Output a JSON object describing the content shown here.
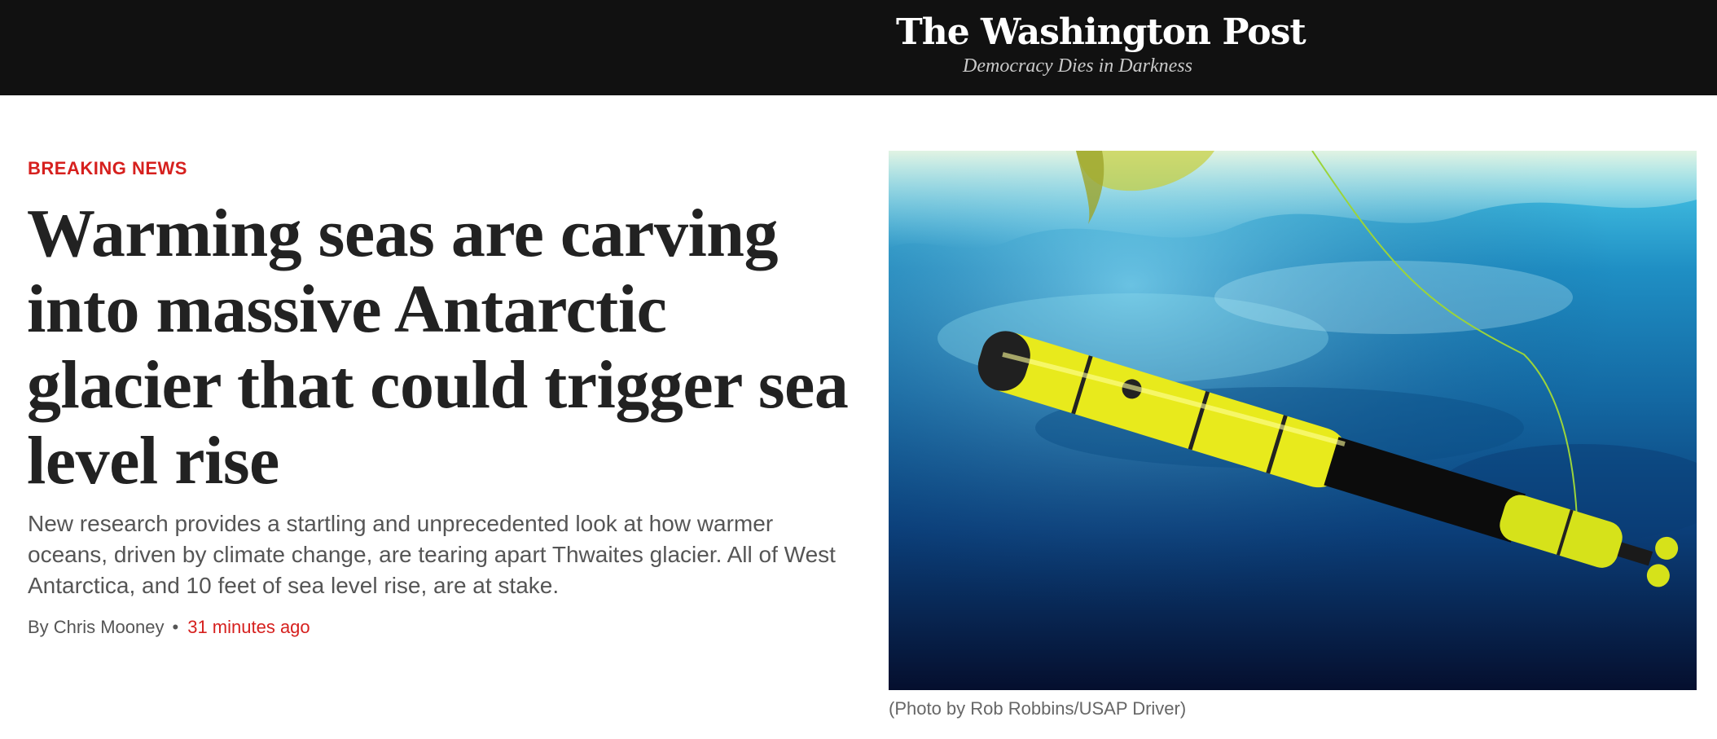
{
  "masthead": {
    "logo": "The Washington Post",
    "tagline": "Democracy Dies in Darkness"
  },
  "story": {
    "kicker": "BREAKING NEWS",
    "headline": "Warming seas are carving into massive Antarctic glacier that could trigger sea level rise",
    "dek": "New research provides a startling and unprecedented look at how warmer oceans, driven by climate change, are tearing apart Thwaites glacier. All of West Antarctica, and 10 feet of sea level rise, are at stake.",
    "byline": "By Chris Mooney",
    "byline_separator": "•",
    "timestamp": "31 minutes ago"
  },
  "photo": {
    "caption": "(Photo by Rob Robbins/USAP Driver)",
    "colors": {
      "water_top": "#4fd0ec",
      "water_bottom": "#050f2e",
      "vehicle_yellow": "#e8ea1c",
      "vehicle_black": "#0c0c0c"
    }
  },
  "colors": {
    "masthead_bg": "#111111",
    "accent_red": "#d6201e",
    "headline": "#222222",
    "body_text": "#555555"
  }
}
